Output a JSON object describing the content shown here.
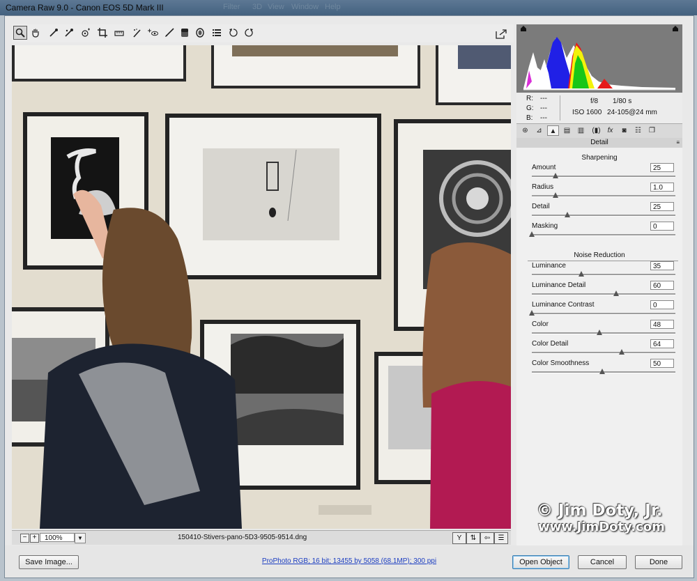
{
  "window": {
    "title": "Camera Raw 9.0  -  Canon EOS 5D Mark III",
    "ghost_menu": [
      "Filter",
      "3D",
      "View",
      "Window",
      "Help"
    ]
  },
  "toolbar": {
    "tools": [
      {
        "icon": "zoom-icon",
        "glyph": "🔍"
      },
      {
        "icon": "hand-icon",
        "glyph": "✋"
      },
      {
        "icon": "white-balance-icon",
        "glyph": "⟋"
      },
      {
        "icon": "color-sampler-icon",
        "glyph": "⟋"
      },
      {
        "icon": "targeted-adjustment-icon",
        "glyph": "⊙"
      },
      {
        "icon": "crop-icon",
        "glyph": "⌗"
      },
      {
        "icon": "straighten-icon",
        "glyph": "▭"
      },
      {
        "icon": "spot-removal-icon",
        "glyph": "⟋"
      },
      {
        "icon": "red-eye-icon",
        "glyph": "+"
      },
      {
        "icon": "red-eye-eye-icon",
        "glyph": "👁"
      },
      {
        "icon": "adjustment-brush-icon",
        "glyph": "⟋"
      },
      {
        "icon": "graduated-filter-icon",
        "glyph": "▮"
      },
      {
        "icon": "radial-filter-icon",
        "glyph": "◎"
      },
      {
        "icon": "preferences-list-icon",
        "glyph": "☰"
      },
      {
        "icon": "rotate-ccw-icon",
        "glyph": "↺"
      },
      {
        "icon": "rotate-cw-icon",
        "glyph": "↻"
      }
    ],
    "fullscreen_icon": "open-fullscreen-icon"
  },
  "image_status": {
    "zoom": "100%",
    "filename": "150410-Stivers-pano-5D3-9505-9514.dng"
  },
  "info": {
    "r": "R:",
    "g": "G:",
    "b": "B:",
    "r_val": "---",
    "g_val": "---",
    "b_val": "---",
    "aperture": "f/8",
    "shutter": "1/80 s",
    "iso": "ISO 1600",
    "lens": "24-105@24 mm"
  },
  "panel": {
    "title": "Detail",
    "sharpening_title": "Sharpening",
    "noise_title": "Noise Reduction",
    "sharpening": [
      {
        "label": "Amount",
        "value": "25",
        "fraction": 0.17
      },
      {
        "label": "Radius",
        "value": "1.0",
        "fraction": 0.17
      },
      {
        "label": "Detail",
        "value": "25",
        "fraction": 0.25
      },
      {
        "label": "Masking",
        "value": "0",
        "fraction": 0.0
      }
    ],
    "noise": [
      {
        "label": "Luminance",
        "value": "35",
        "fraction": 0.35
      },
      {
        "label": "Luminance Detail",
        "value": "60",
        "fraction": 0.6
      },
      {
        "label": "Luminance Contrast",
        "value": "0",
        "fraction": 0.0
      },
      {
        "label": "Color",
        "value": "48",
        "fraction": 0.48
      },
      {
        "label": "Color Detail",
        "value": "64",
        "fraction": 0.64
      },
      {
        "label": "Color Smoothness",
        "value": "50",
        "fraction": 0.5
      }
    ]
  },
  "bottom": {
    "save_label": "Save Image...",
    "workflow_link": "ProPhoto RGB; 16 bit; 13455 by 5058 (68.1MP); 300 ppi",
    "open_label": "Open Object",
    "cancel_label": "Cancel",
    "done_label": "Done"
  },
  "watermark": {
    "line1": "© Jim Doty, Jr.",
    "line2": "www.JimDoty.com"
  }
}
